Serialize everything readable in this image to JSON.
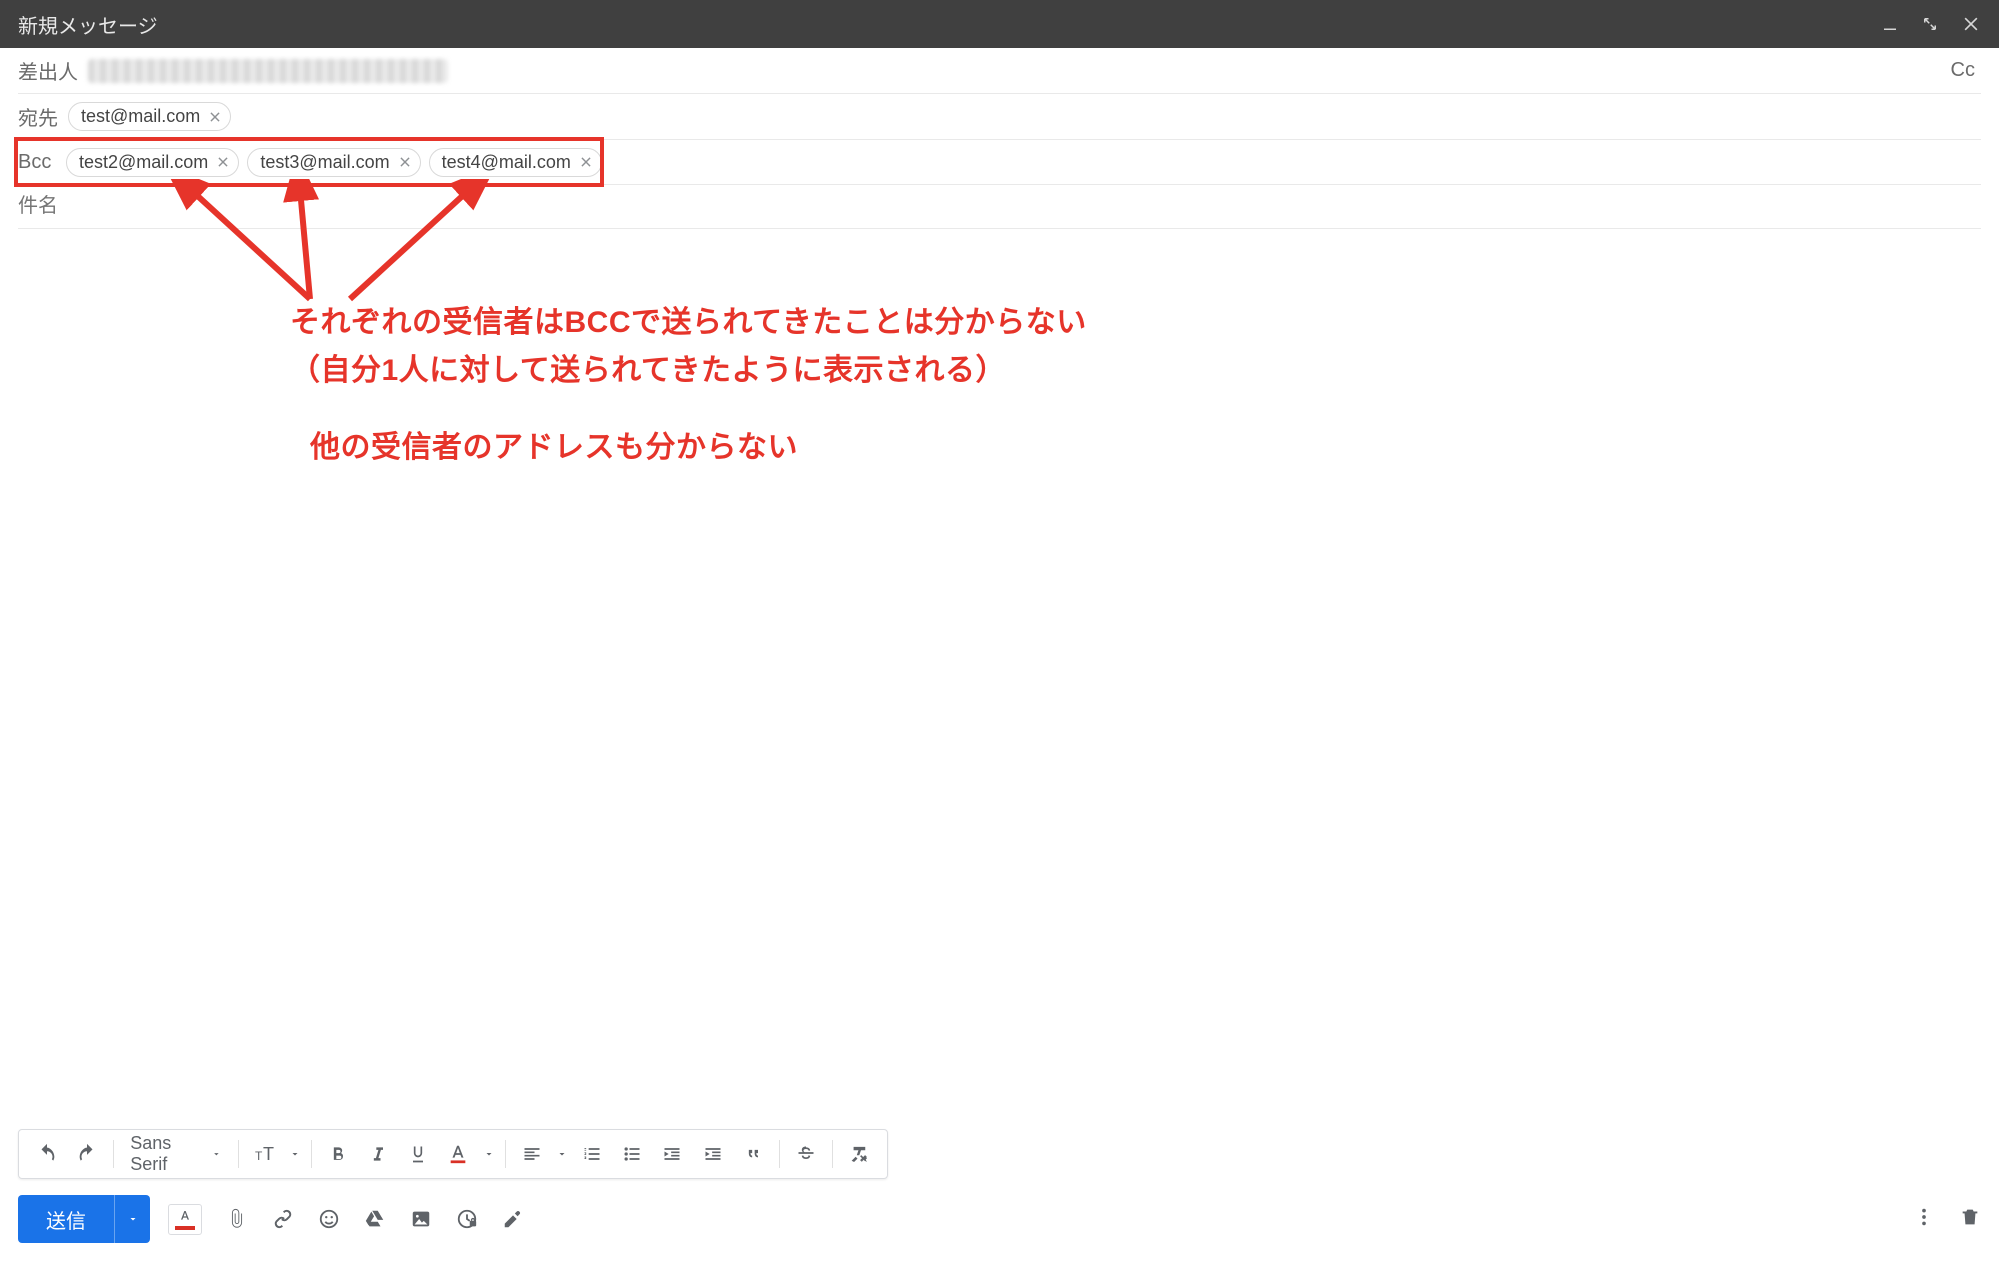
{
  "window": {
    "title": "新規メッセージ"
  },
  "fields": {
    "from_label": "差出人",
    "to_label": "宛先",
    "bcc_label": "Bcc",
    "subject_placeholder": "件名",
    "cc_label": "Cc"
  },
  "recipients": {
    "to": [
      "test@mail.com"
    ],
    "bcc": [
      "test2@mail.com",
      "test3@mail.com",
      "test4@mail.com"
    ]
  },
  "annotations": {
    "line1": "それぞれの受信者はBCCで送られてきたことは分からない",
    "line2": "（自分1人に対して送られてきたように表示される）",
    "line3": "他の受信者のアドレスも分からない"
  },
  "format_toolbar": {
    "font": "Sans Serif"
  },
  "actions": {
    "send_label": "送信"
  }
}
